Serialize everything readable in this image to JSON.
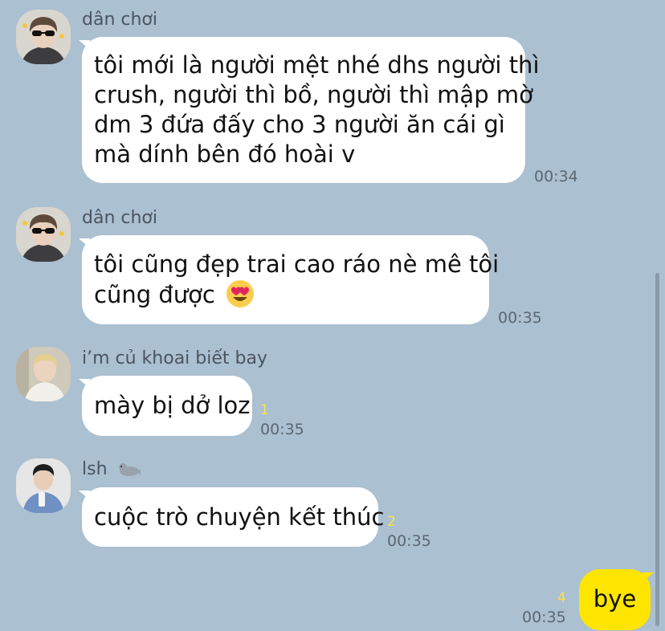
{
  "messages": [
    {
      "sender": "dân chơi",
      "avatar": "sunglasses-guy-avatar",
      "lines": [
        "tôi mới là người mệt nhé dhs người thì",
        "crush, người thì bồ, người thì mập mờ",
        "dm 3 đứa đấy cho 3 người ăn cái gì",
        "mà dính bên đó hoài v"
      ],
      "time": "00:34",
      "unread": ""
    },
    {
      "sender": "dân chơi",
      "avatar": "sunglasses-guy-avatar",
      "lines": [
        "tôi cũng đẹp trai cao ráo nè mê tôi",
        "cũng được"
      ],
      "emoji": "heart-eyes-emoji",
      "time": "00:35",
      "unread": ""
    },
    {
      "sender": "i’m củ khoai biết bay",
      "avatar": "blond-guy-avatar",
      "lines": [
        "mày bị dở loz"
      ],
      "time": "00:35",
      "unread": "1"
    },
    {
      "sender": "lsh",
      "sender_emoji": "seal-emoji",
      "avatar": "denim-jacket-guy-avatar",
      "lines": [
        "cuộc trò chuyện kết thúc"
      ],
      "time": "00:35",
      "unread": "2"
    }
  ],
  "my_message": {
    "text": "bye",
    "time": "00:35",
    "unread": "4"
  },
  "colors": {
    "background": "#abc0d1",
    "incoming_bubble": "#ffffff",
    "outgoing_bubble": "#fee500",
    "unread_count": "#fde049",
    "timestamp": "#5c6772"
  }
}
